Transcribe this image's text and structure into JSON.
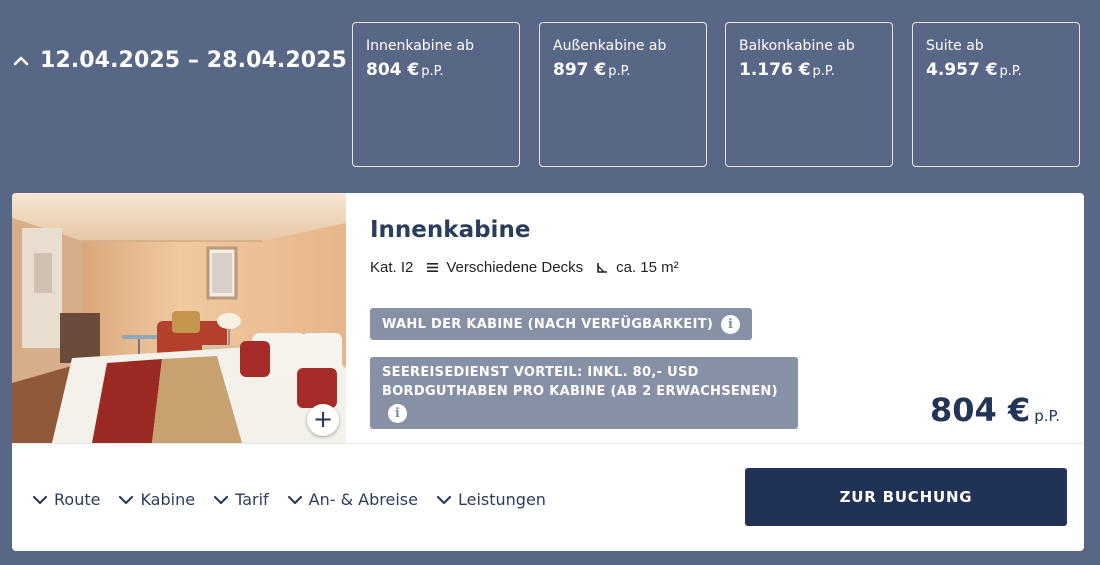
{
  "header": {
    "date_range": "12.04.2025 – 28.04.2025"
  },
  "price_boxes": [
    {
      "label": "Innenkabine ab",
      "price": "804 €",
      "unit": "p.P."
    },
    {
      "label": "Außenkabine ab",
      "price": "897 €",
      "unit": "p.P."
    },
    {
      "label": "Balkonkabine ab",
      "price": "1.176 €",
      "unit": "p.P."
    },
    {
      "label": "Suite ab",
      "price": "4.957 €",
      "unit": "p.P."
    }
  ],
  "card": {
    "title": "Innenkabine",
    "category": "Kat. I2",
    "deck": "Verschiedene Decks",
    "size": "ca. 15 m²",
    "badge_1": "WAHL DER KABINE (NACH VERFÜGBARKEIT)",
    "badge_2_line1": "SEEREISEDIENST VORTEIL: INKL. 80,- USD",
    "badge_2_line2": "BORDGUTHABEN PRO KABINE (AB 2 ERWACHSENEN)",
    "price": "804 €",
    "price_unit": "p.P.",
    "plus": "+",
    "info_glyph": "i"
  },
  "tabs": [
    {
      "label": "Route"
    },
    {
      "label": "Kabine"
    },
    {
      "label": "Tarif"
    },
    {
      "label": "An- & Abreise"
    },
    {
      "label": "Leistungen"
    }
  ],
  "book_button": "ZUR BUCHUNG",
  "icons": {
    "toggle": "chevron-up-icon",
    "tab": "chevron-down-icon",
    "deck": "list-icon",
    "size": "area-icon",
    "info": "info-icon",
    "expand": "plus-icon"
  },
  "colors": {
    "background": "#596787",
    "card": "#ffffff",
    "primary": "#203256",
    "badge": "#8890a6"
  }
}
